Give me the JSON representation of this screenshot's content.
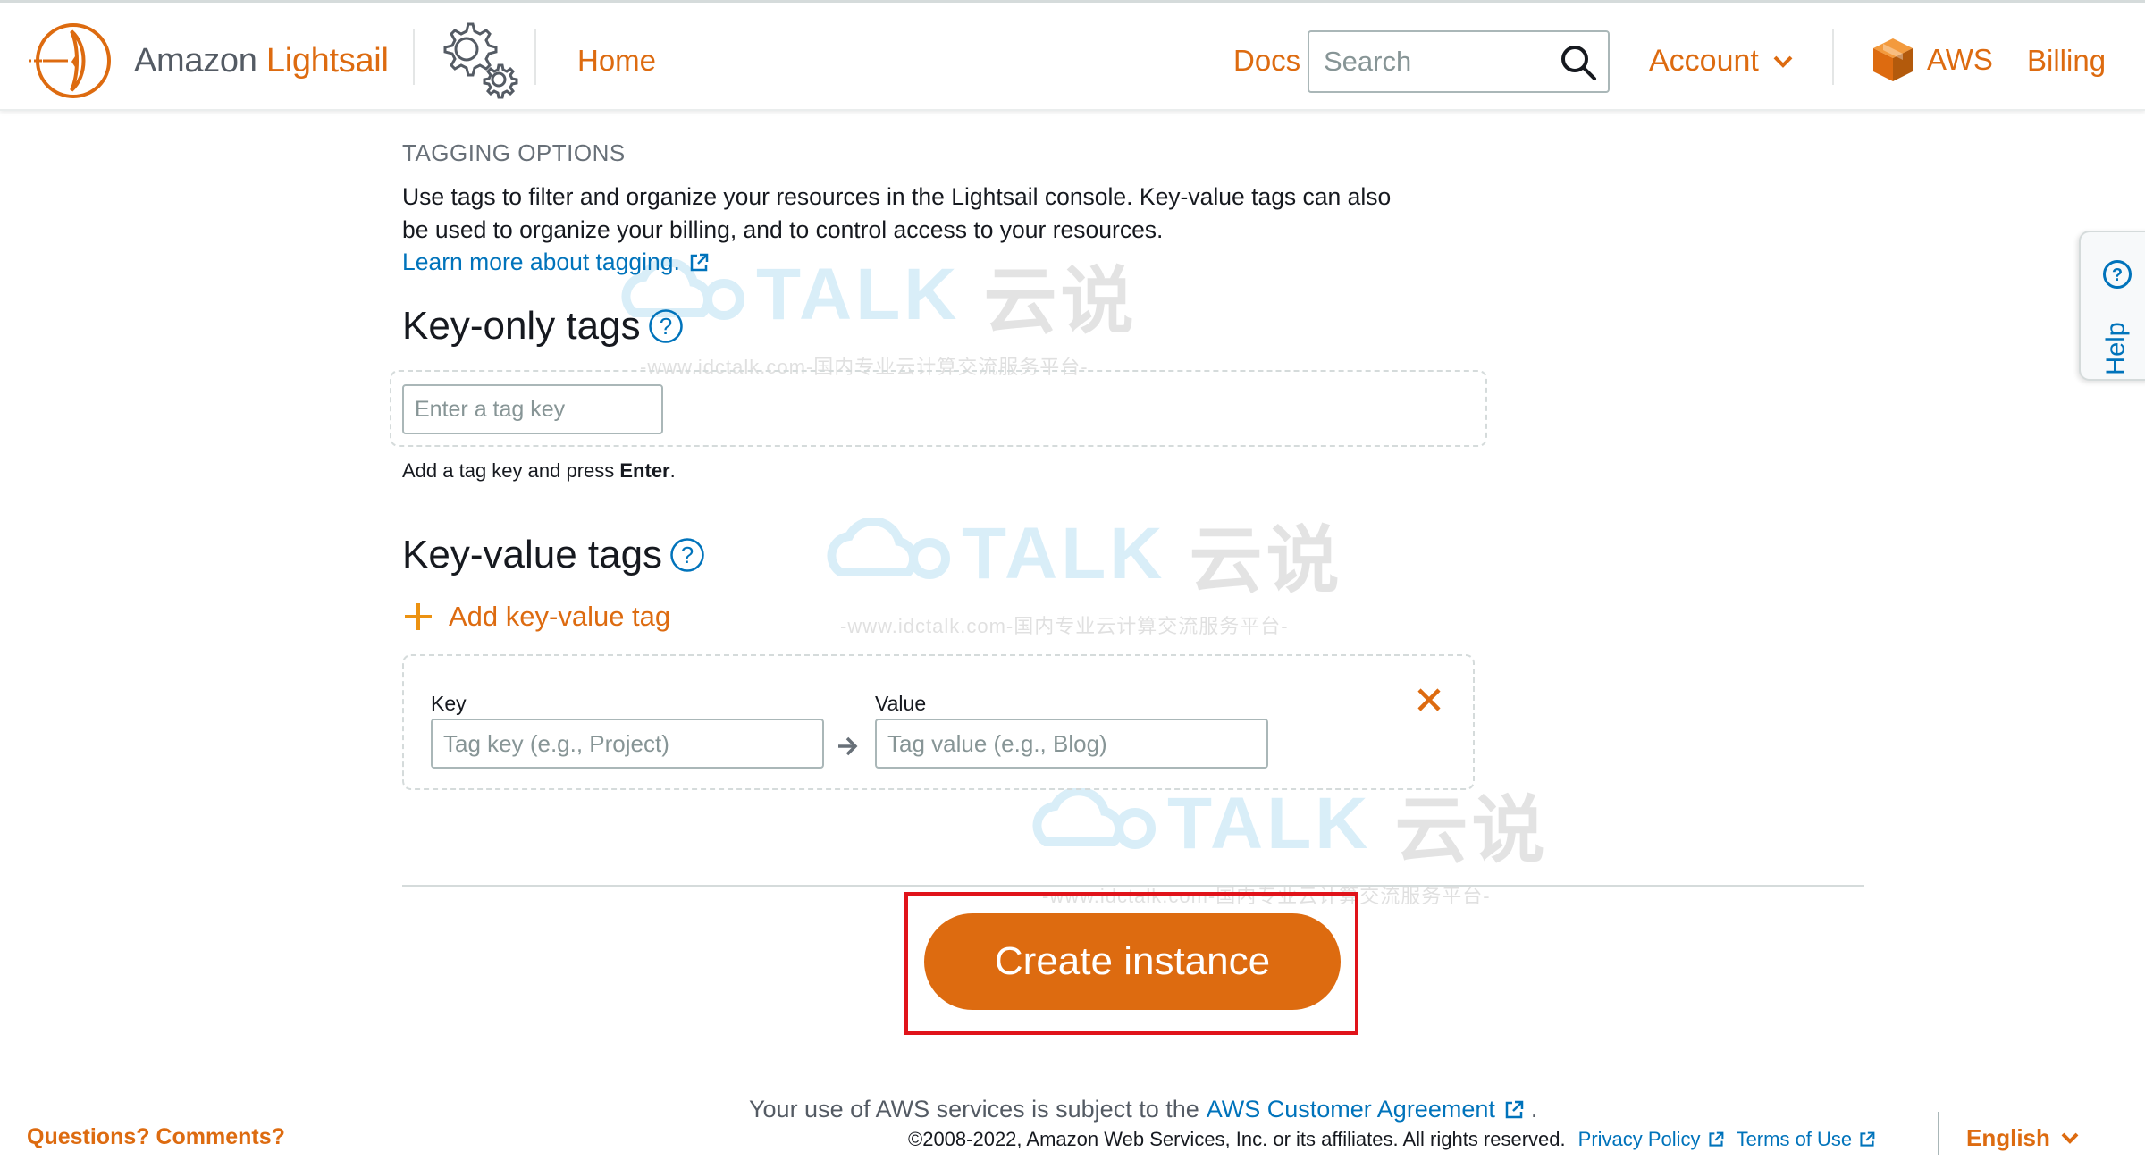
{
  "header": {
    "brand_prefix": "Amazon",
    "brand_name": "Lightsail",
    "nav_home": "Home",
    "nav_docs": "Docs",
    "search_placeholder": "Search",
    "nav_account": "Account",
    "nav_aws": "AWS",
    "nav_billing": "Billing"
  },
  "help_tab": {
    "label": "Help"
  },
  "tagging": {
    "section_title": "TAGGING OPTIONS",
    "description": "Use tags to filter and organize your resources in the Lightsail console. Key-value tags can also be used to organize your billing, and to control access to your resources.",
    "learn_more": "Learn more about tagging.",
    "key_only_heading": "Key-only tags",
    "tag_key_placeholder": "Enter a tag key",
    "hint_prefix": "Add a tag key and press ",
    "hint_key": "Enter",
    "hint_suffix": ".",
    "key_value_heading": "Key-value tags",
    "add_kv_label": "Add key-value tag",
    "key_label": "Key",
    "key_placeholder": "Tag key (e.g., Project)",
    "value_label": "Value",
    "value_placeholder": "Tag value (e.g., Blog)"
  },
  "actions": {
    "create_label": "Create instance"
  },
  "watermark": {
    "brand": "TALK",
    "cn": "云说",
    "url": "-www.idctalk.com-国内专业云计算交流服务平台-"
  },
  "footer": {
    "questions": "Questions? Comments?",
    "terms_prefix": "Your use of AWS services is subject to the",
    "terms_link": "AWS Customer Agreement",
    "terms_suffix": ".",
    "copyright": "©2008-2022, Amazon Web Services, Inc. or its affiliates. All rights reserved.",
    "privacy": "Privacy Policy",
    "terms_of_use": "Terms of Use",
    "language": "English"
  },
  "colors": {
    "accent": "#dd6b10",
    "link": "#0073bb",
    "highlight_box": "#e0131a"
  }
}
